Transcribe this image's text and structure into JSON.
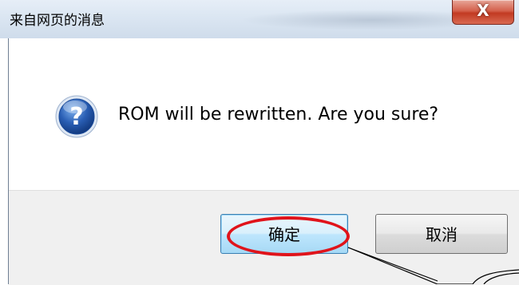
{
  "window": {
    "title": "来自网页的消息",
    "close_label": "X"
  },
  "message": {
    "icon": "question-icon",
    "text": "ROM will be rewritten.  Are you sure?"
  },
  "buttons": {
    "ok_label": "确定",
    "cancel_label": "取消"
  },
  "annotation": {
    "ring_color": "#e0141b"
  },
  "colors": {
    "icon_blue": "#2a5fb5",
    "button_focus_border": "#3c7fb1"
  }
}
